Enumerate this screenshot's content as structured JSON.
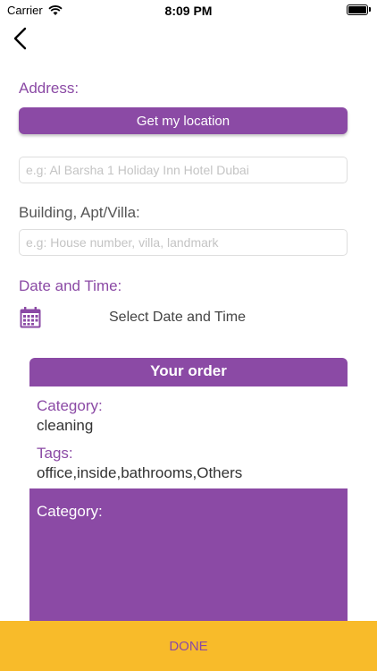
{
  "status_bar": {
    "carrier": "Carrier",
    "time": "8:09 PM"
  },
  "address": {
    "label": "Address:",
    "location_button": "Get my location",
    "placeholder": "e.g: Al Barsha 1 Holiday Inn Hotel Dubai"
  },
  "building": {
    "label": "Building, Apt/Villa:",
    "placeholder": "e.g: House number, villa, landmark"
  },
  "date_time": {
    "label": "Date and Time:",
    "select_text": "Select Date and Time"
  },
  "order": {
    "title": "Your order",
    "category_label": "Category:",
    "category_value": "cleaning",
    "tags_label": "Tags:",
    "tags_value": "office,inside,bathrooms,Others",
    "second_category_label": "Category:"
  },
  "done_label": "DONE",
  "colors": {
    "accent": "#8b4aa5",
    "done_bar": "#f8bb2a"
  },
  "icons": [
    "wifi-icon",
    "battery-icon",
    "back-chevron-icon",
    "calendar-icon"
  ]
}
